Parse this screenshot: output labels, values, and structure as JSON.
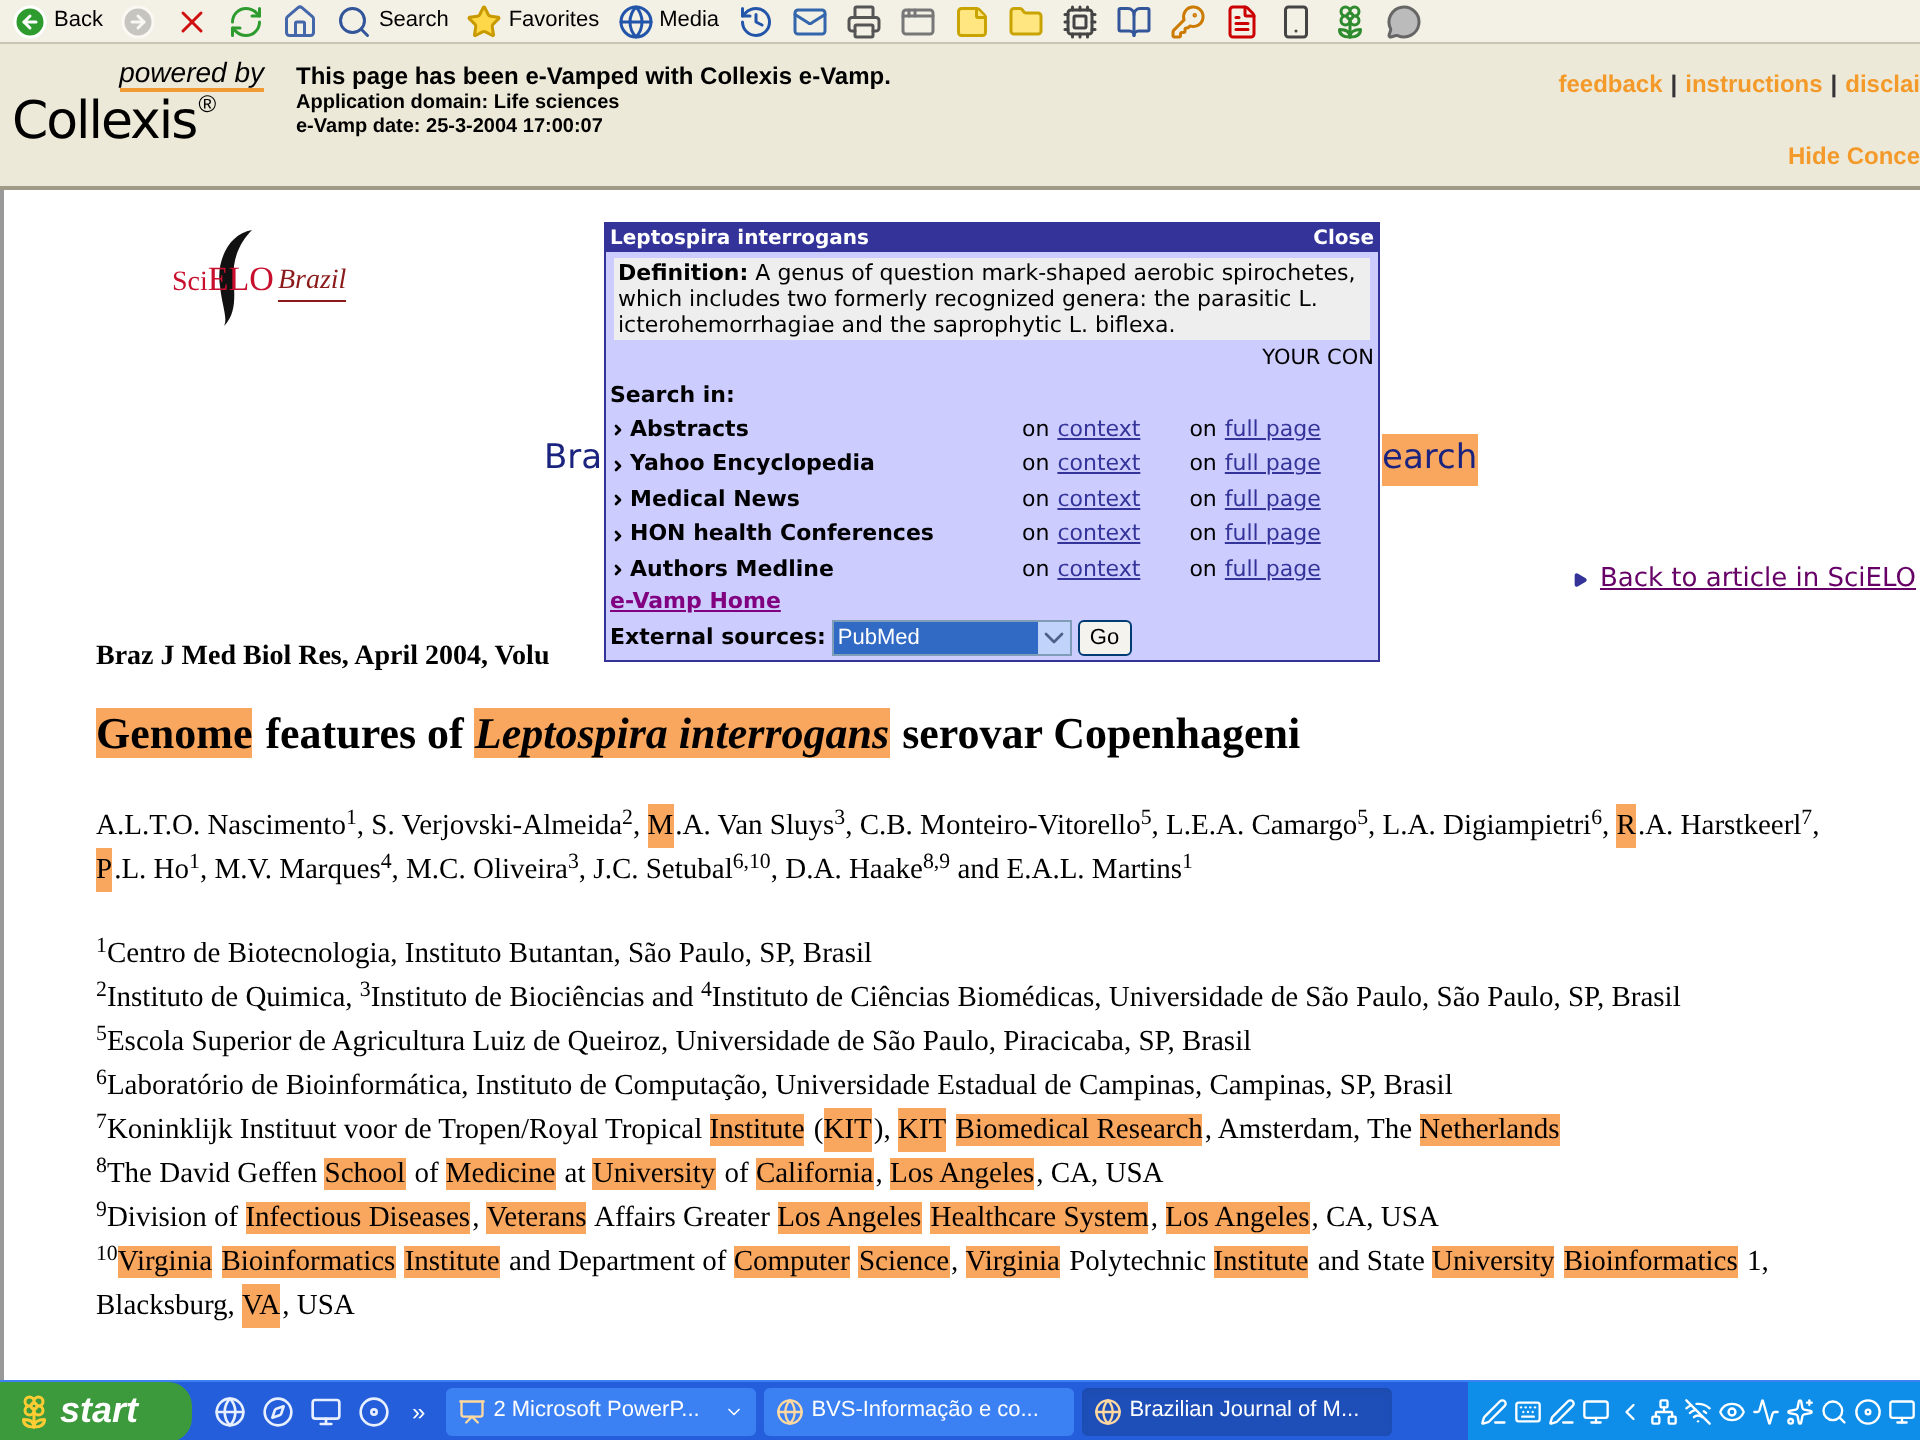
{
  "toolbar": [
    {
      "kind": "back",
      "label": "Back",
      "disabled": false
    },
    {
      "kind": "forward",
      "disabled": true
    },
    {
      "kind": "stop",
      "disabled": false
    },
    {
      "kind": "refresh",
      "disabled": false
    },
    {
      "kind": "home",
      "disabled": false
    },
    {
      "kind": "search",
      "label": "Search",
      "disabled": false
    },
    {
      "kind": "favorites",
      "label": "Favorites",
      "disabled": false
    },
    {
      "kind": "media",
      "label": "Media",
      "disabled": false
    },
    {
      "kind": "history",
      "disabled": false
    },
    {
      "kind": "mail",
      "disabled": false
    },
    {
      "kind": "print",
      "disabled": false
    },
    {
      "kind": "window",
      "disabled": false
    },
    {
      "kind": "note",
      "disabled": false
    },
    {
      "kind": "folder",
      "disabled": false
    },
    {
      "kind": "chip",
      "disabled": false
    },
    {
      "kind": "book",
      "disabled": false
    },
    {
      "kind": "key",
      "disabled": false
    },
    {
      "kind": "pdf",
      "disabled": false
    },
    {
      "kind": "device",
      "disabled": false
    },
    {
      "kind": "plant",
      "disabled": false
    },
    {
      "kind": "chat",
      "disabled": false
    }
  ],
  "banner": {
    "logo_tag": "powered by",
    "logo_name": "Collexis",
    "logo_mark": "®",
    "title": "This page has been e-Vamped with Collexis e-Vamp.",
    "domain": "Application domain: Life sciences",
    "date": "e-Vamp date: 25-3-2004 17:00:07",
    "links": [
      "feedback",
      "instructions",
      "disclai"
    ],
    "separators": [
      "|",
      "|"
    ],
    "hide": "Hide Conce"
  },
  "article": {
    "logo": {
      "small": "Sci",
      "large": "ELO",
      "tagline": "Brazil"
    },
    "partial_left": "Bra",
    "partial_right": "earch",
    "back_link": "Back to article in SciELO",
    "citation": "Braz J Med Biol Res, April 2004, Volu",
    "title": [
      {
        "text": "Genome",
        "highlighted": true
      },
      {
        "text": " features of ",
        "highlighted": false
      },
      {
        "text": "*Leptospira interrogans*",
        "highlighted": true
      },
      {
        "text": " serovar Copenhageni",
        "highlighted": false
      }
    ],
    "authors": [
      {
        "text": "A.L.T.O. Nascimento$^{1}$, S. Verjovski-Almeida$^{2}$, ",
        "highlighted": false
      },
      {
        "text": "M",
        "highlighted": true
      },
      {
        "text": ".A. Van Sluys$^{3}$, C.B. Monteiro-Vitorello$^{5}$, L.E.A. Camargo$^{5}$, L.A. Digiampietri$^{6}$, ",
        "highlighted": false
      },
      {
        "text": "R",
        "highlighted": true
      },
      {
        "text": ".A. Harstkeerl$^{7}$, ",
        "highlighted": false
      },
      {
        "text": "P",
        "highlighted": true
      },
      {
        "text": ".L. Ho$^{1}$, M.V. Marques$^{4}$, M.C. Oliveira$^{3}$, J.C. Setubal$^{6,10}$, D.A. Haake$^{8,9}$ and E.A.L. Martins$^{1}$",
        "highlighted": false
      }
    ],
    "affiliations": [
      [
        {
          "text": "$^{1}$Centro de Biotecnologia, Instituto Butantan, São Paulo, SP, Brasil",
          "highlighted": false
        }
      ],
      [
        {
          "text": "$^{2}$Instituto de Quimica, $^{3}$Instituto de Biociências and $^{4}$Instituto de Ciências Biomédicas, Universidade de São Paulo, São Paulo, SP, Brasil",
          "highlighted": false
        }
      ],
      [
        {
          "text": "$^{5}$Escola Superior de Agricultura Luiz de Queiroz, Universidade de São Paulo, Piracicaba, SP, Brasil",
          "highlighted": false
        }
      ],
      [
        {
          "text": "$^{6}$Laboratório de Bioinformática, Instituto de Computação, Universidade Estadual de Campinas, Campinas, SP, Brasil",
          "highlighted": false
        }
      ],
      [
        {
          "text": "$^{7}$Koninklijk Instituut voor de Tropen/Royal Tropical ",
          "highlighted": false
        },
        {
          "text": "Institute",
          "highlighted": true
        },
        {
          "text": " (",
          "highlighted": false
        },
        {
          "text": "KIT",
          "highlighted": true
        },
        {
          "text": "), ",
          "highlighted": false
        },
        {
          "text": "KIT",
          "highlighted": true
        },
        {
          "text": "Biomedical Research",
          "highlighted": true
        },
        {
          "text": ", Amsterdam, The ",
          "highlighted": false
        },
        {
          "text": "Netherlands",
          "highlighted": true
        }
      ],
      [
        {
          "text": "$^{8}$The David Geffen ",
          "highlighted": false
        },
        {
          "text": "School",
          "highlighted": true
        },
        {
          "text": " of ",
          "highlighted": false
        },
        {
          "text": "Medicine",
          "highlighted": true
        },
        {
          "text": " at ",
          "highlighted": false
        },
        {
          "text": "University",
          "highlighted": true
        },
        {
          "text": " of ",
          "highlighted": false
        },
        {
          "text": "California",
          "highlighted": true
        },
        {
          "text": ", ",
          "highlighted": false
        },
        {
          "text": "Los Angeles",
          "highlighted": true
        },
        {
          "text": ", CA, USA",
          "highlighted": false
        }
      ],
      [
        {
          "text": "$^{9}$Division of ",
          "highlighted": false
        },
        {
          "text": "Infectious Diseases",
          "highlighted": true
        },
        {
          "text": ", ",
          "highlighted": false
        },
        {
          "text": "Veterans",
          "highlighted": true
        },
        {
          "text": " Affairs Greater ",
          "highlighted": false
        },
        {
          "text": "Los Angeles",
          "highlighted": true
        },
        {
          "text": "Healthcare System",
          "highlighted": true
        },
        {
          "text": ", ",
          "highlighted": false
        },
        {
          "text": "Los Angeles",
          "highlighted": true
        },
        {
          "text": ", CA, USA",
          "highlighted": false
        }
      ],
      [
        {
          "text": "$^{10}$",
          "highlighted": false
        },
        {
          "text": "Virginia",
          "highlighted": true
        },
        {
          "text": "Bioinformatics",
          "highlighted": true
        },
        {
          "text": "Institute",
          "highlighted": true
        },
        {
          "text": " and Department of ",
          "highlighted": false
        },
        {
          "text": "Computer",
          "highlighted": true
        },
        {
          "text": "Science",
          "highlighted": true
        },
        {
          "text": ", ",
          "highlighted": false
        },
        {
          "text": "Virginia",
          "highlighted": true
        },
        {
          "text": " Polytechnic ",
          "highlighted": false
        },
        {
          "text": "Institute",
          "highlighted": true
        },
        {
          "text": " and State ",
          "highlighted": false
        },
        {
          "text": "University",
          "highlighted": true
        },
        {
          "text": "Bioinformatics",
          "highlighted": true
        },
        {
          "text": " 1, Blacksburg, ",
          "highlighted": false
        },
        {
          "text": "VA",
          "highlighted": true
        },
        {
          "text": ", USA",
          "highlighted": false
        }
      ]
    ]
  },
  "popup": {
    "title": "Leptospira interrogans",
    "close": "Close",
    "definition": "**Definition:** A genus of question mark-shaped aerobic spirochetes, which includes two formerly recognized genera: the parasitic L. icterohemorrhagiae and the saprophytic L. biflexa.",
    "partial_banner": "YOUR CON",
    "search_label": "Search in:",
    "sources": [
      {
        "name": "Abstracts",
        "on_context": "on",
        "context": "context",
        "on_page": "on",
        "page": "full page"
      },
      {
        "name": "Yahoo Encyclopedia",
        "on_context": "on",
        "context": "context",
        "on_page": "on",
        "page": "full page"
      },
      {
        "name": "Medical News",
        "on_context": "on",
        "context": "context",
        "on_page": "on",
        "page": "full page"
      },
      {
        "name": "HON health Conferences",
        "on_context": "on",
        "context": "context",
        "on_page": "on",
        "page": "full page"
      },
      {
        "name": "Authors Medline",
        "on_context": "on",
        "context": "context",
        "on_page": "on",
        "page": "full page"
      }
    ],
    "home_link": "e-Vamp Home",
    "external_label": "External sources:",
    "external_value": "PubMed",
    "go": "Go"
  },
  "taskbar": {
    "start": "start",
    "overflow": "»",
    "quick_launch": [
      {
        "kind": "browser"
      },
      {
        "kind": "browser-alt"
      },
      {
        "kind": "desktop"
      },
      {
        "kind": "media"
      }
    ],
    "tasks": [
      {
        "kind": "slides",
        "label": "2 Microsoft PowerP...",
        "grouped": true,
        "selected": false
      },
      {
        "kind": "browser",
        "label": "BVS-Informação e co...",
        "grouped": false,
        "selected": false
      },
      {
        "kind": "browser",
        "label": "Brazilian Journal of M...",
        "grouped": false,
        "selected": true
      }
    ],
    "tray": [
      {
        "kind": "pen"
      },
      {
        "kind": "keyboard"
      },
      {
        "kind": "pen"
      },
      {
        "kind": "monitor"
      },
      {
        "kind": "back"
      },
      {
        "kind": "network"
      },
      {
        "kind": "network-off"
      },
      {
        "kind": "eye"
      },
      {
        "kind": "wave"
      },
      {
        "kind": "burst"
      },
      {
        "kind": "search"
      },
      {
        "kind": "disc"
      },
      {
        "kind": "monitor"
      }
    ]
  }
}
